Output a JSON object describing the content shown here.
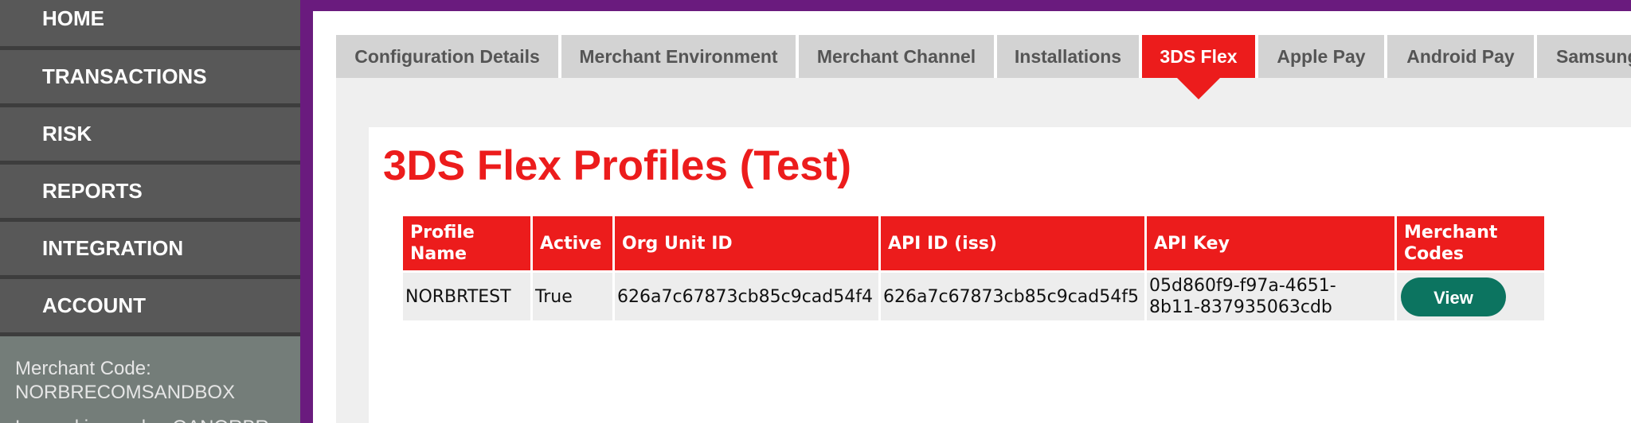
{
  "sidebar": {
    "items": [
      {
        "label": "HOME"
      },
      {
        "label": "TRANSACTIONS"
      },
      {
        "label": "RISK"
      },
      {
        "label": "REPORTS"
      },
      {
        "label": "INTEGRATION"
      },
      {
        "label": "ACCOUNT"
      }
    ],
    "merchant_code_label": "Merchant Code:",
    "merchant_code_value": "NORBRECOMSANDBOX",
    "logged_in_text": "Logged in as: dev-QANORBR"
  },
  "tabs": [
    {
      "label": "Configuration Details",
      "active": false
    },
    {
      "label": "Merchant Environment",
      "active": false
    },
    {
      "label": "Merchant Channel",
      "active": false
    },
    {
      "label": "Installations",
      "active": false
    },
    {
      "label": "3DS Flex",
      "active": true
    },
    {
      "label": "Apple Pay",
      "active": false
    },
    {
      "label": "Android Pay",
      "active": false
    },
    {
      "label": "Samsung Pay",
      "active": false
    }
  ],
  "page_title": "3DS Flex Profiles (Test)",
  "table": {
    "headers": [
      "Profile Name",
      "Active",
      "Org Unit ID",
      "API ID (iss)",
      "API Key",
      "Merchant Codes"
    ],
    "rows": [
      {
        "profile_name": "NORBRTEST",
        "active": "True",
        "org_unit_id": "626a7c67873cb85c9cad54f4",
        "api_id": "626a7c67873cb85c9cad54f5",
        "api_key_line1": "05d860f9-f97a-4651-",
        "api_key_line2": "8b11-837935063cdb",
        "action_label": "View"
      }
    ]
  },
  "colors": {
    "accent_red": "#ec1c1c",
    "frame_purple": "#6a1b7e",
    "button_green": "#0c7460",
    "sidebar_gray": "#585858"
  }
}
